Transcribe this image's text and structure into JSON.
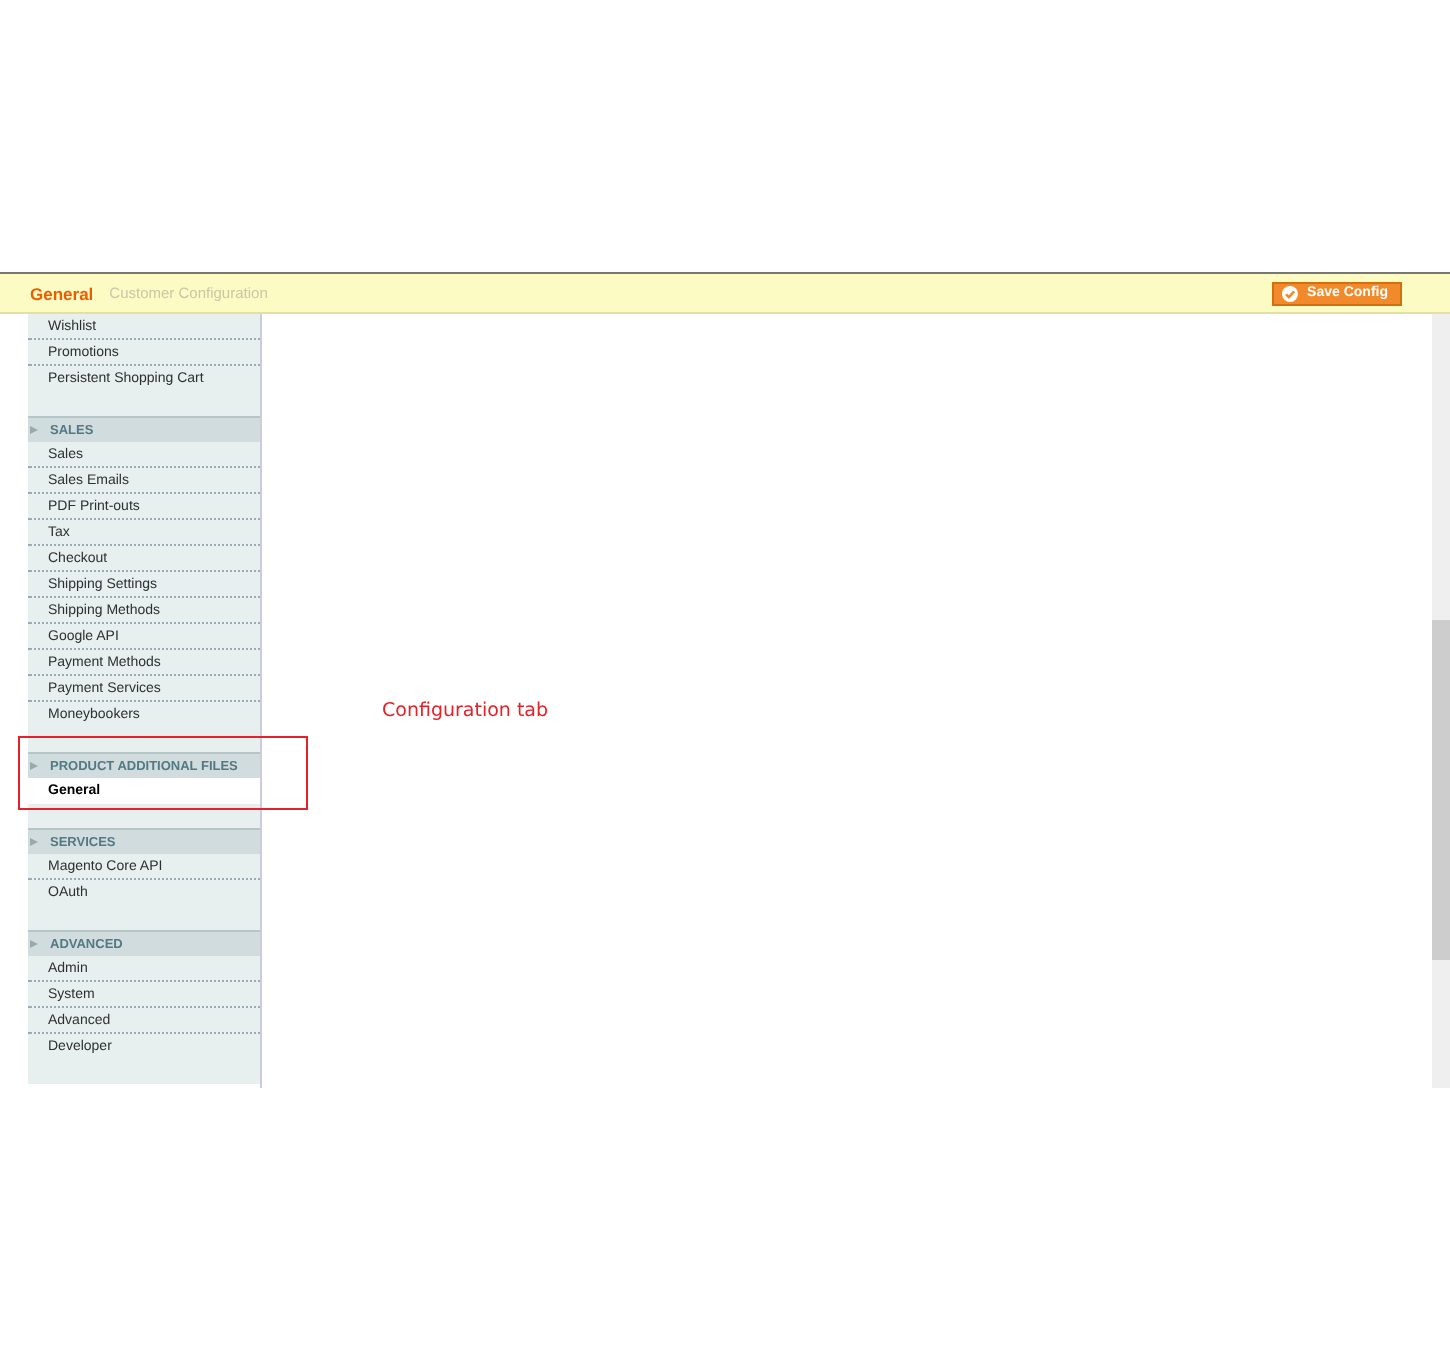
{
  "header": {
    "title": "General",
    "faded_label": "Customer Configuration",
    "save_button": "Save Config"
  },
  "sidebar": {
    "sections": [
      {
        "items": [
          {
            "label": "Wishlist",
            "selected": false
          },
          {
            "label": "Promotions",
            "selected": false
          },
          {
            "label": "Persistent Shopping Cart",
            "selected": false
          }
        ]
      },
      {
        "title": "SALES",
        "items": [
          {
            "label": "Sales",
            "selected": false
          },
          {
            "label": "Sales Emails",
            "selected": false
          },
          {
            "label": "PDF Print-outs",
            "selected": false
          },
          {
            "label": "Tax",
            "selected": false
          },
          {
            "label": "Checkout",
            "selected": false
          },
          {
            "label": "Shipping Settings",
            "selected": false
          },
          {
            "label": "Shipping Methods",
            "selected": false
          },
          {
            "label": "Google API",
            "selected": false
          },
          {
            "label": "Payment Methods",
            "selected": false
          },
          {
            "label": "Payment Services",
            "selected": false
          },
          {
            "label": "Moneybookers",
            "selected": false
          }
        ]
      },
      {
        "title": "PRODUCT ADDITIONAL FILES",
        "highlighted": true,
        "items": [
          {
            "label": "General",
            "selected": true
          }
        ]
      },
      {
        "title": "SERVICES",
        "items": [
          {
            "label": "Magento Core API",
            "selected": false
          },
          {
            "label": "OAuth",
            "selected": false
          }
        ]
      },
      {
        "title": "ADVANCED",
        "items": [
          {
            "label": "Admin",
            "selected": false
          },
          {
            "label": "System",
            "selected": false
          },
          {
            "label": "Advanced",
            "selected": false
          },
          {
            "label": "Developer",
            "selected": false
          }
        ]
      }
    ]
  },
  "annotation": "Configuration tab"
}
